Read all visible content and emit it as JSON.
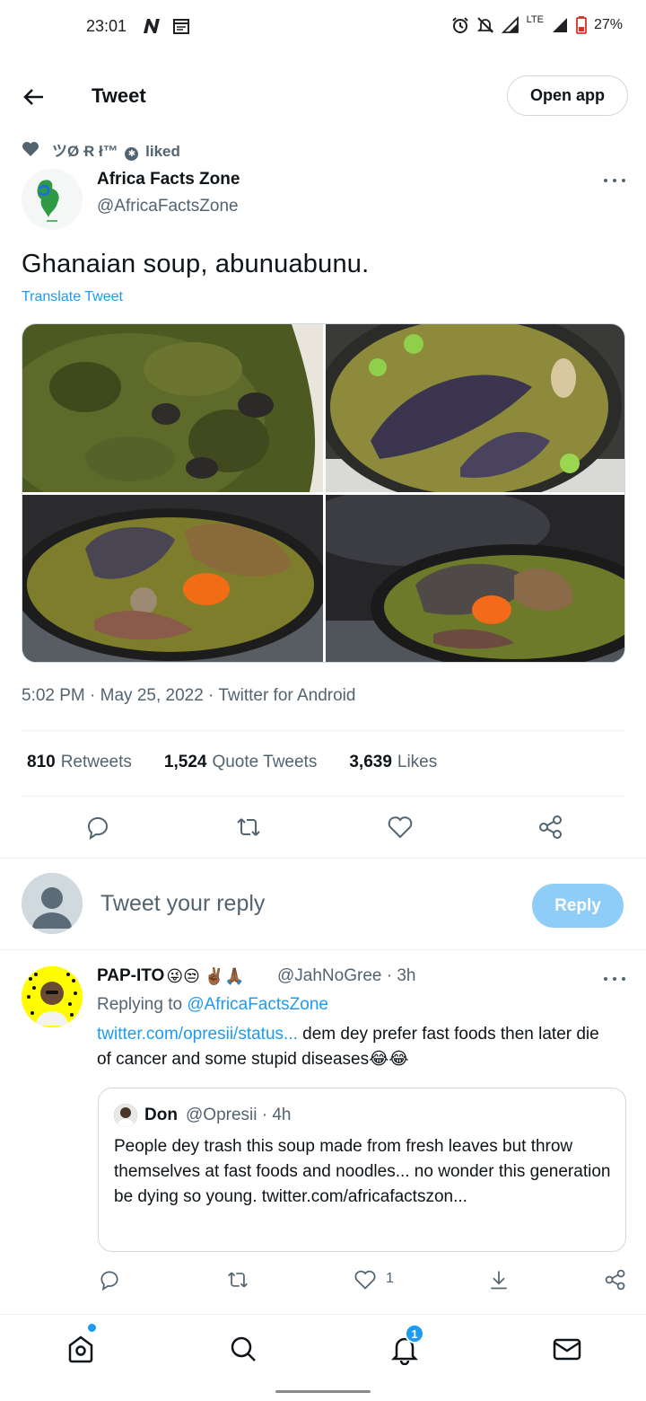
{
  "status_bar": {
    "time": "23:01",
    "battery": "27%",
    "network": "LTE",
    "icons": [
      "n-icon",
      "calendar-icon",
      "alarm-icon",
      "mute-icon",
      "signal-icon",
      "signal-icon",
      "battery-icon"
    ]
  },
  "header": {
    "title": "Tweet",
    "open_app": "Open app"
  },
  "social_context": {
    "liker": "ツØ Ɍ ł™",
    "badge": "✱",
    "text": "liked"
  },
  "tweet": {
    "author_name": "Africa Facts Zone",
    "author_handle": "@AfricaFactsZone",
    "text": "Ghanaian soup, abunuabunu.",
    "translate": "Translate Tweet",
    "timestamp": "5:02 PM · May 25, 2022 · Twitter for Android",
    "media_count": 4
  },
  "stats": {
    "retweets_count": "810",
    "retweets_label": "Retweets",
    "quotes_count": "1,524",
    "quotes_label": "Quote Tweets",
    "likes_count": "3,639",
    "likes_label": "Likes"
  },
  "composer": {
    "placeholder": "Tweet your reply",
    "button": "Reply"
  },
  "reply": {
    "name": "PAP-ITO",
    "emojis": "😜😒 ✌🏾🙏🏾",
    "meta": "@JahNoGree · 3h",
    "replying_prefix": "Replying to",
    "replying_handle": "@AfricaFactsZone",
    "link": "twitter.com/opresii/status...",
    "body": "dem dey prefer fast foods then later die of cancer and some stupid diseases😂😂",
    "like_count": "1",
    "quote": {
      "name": "Don",
      "meta": "@Opresii · 4h",
      "body": "People dey  trash this soup made from fresh leaves but throw themselves at fast foods and noodles... no wonder this generation be dying so young. twitter.com/africafactszon..."
    }
  },
  "bottom_nav": {
    "notifications_badge": "1",
    "items": [
      "home-icon",
      "search-icon",
      "notifications-icon",
      "messages-icon"
    ]
  },
  "colors": {
    "accent": "#1d9bf0",
    "text": "#0f1419",
    "secondary": "#536471",
    "reply_button": "#8ecdf8"
  }
}
